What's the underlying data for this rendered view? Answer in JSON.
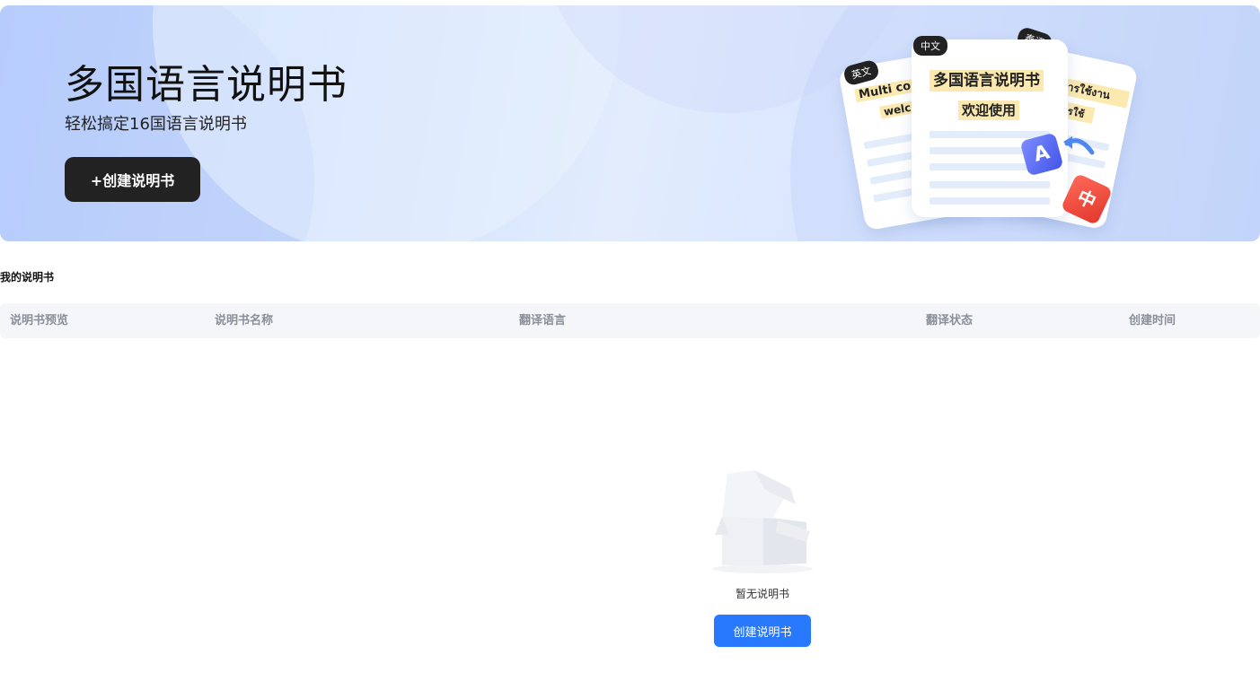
{
  "banner": {
    "title": "多国语言说明书",
    "subtitle": "轻松搞定16国语言说明书",
    "create_button": "+创建说明书",
    "illustration": {
      "tag_left": "英文",
      "tag_center": "中文",
      "tag_right": "泰语",
      "left_line1": "Multi co",
      "left_line2": "welc",
      "center_line1": "多国语言说明书",
      "center_line2": "欢迎使用",
      "right_line1": "การใช้งาน",
      "right_line2": "การใช้",
      "badge_a": "A",
      "badge_zh": "中"
    }
  },
  "section": {
    "title": "我的说明书"
  },
  "table": {
    "columns": [
      "说明书预览",
      "说明书名称",
      "翻译语言",
      "翻译状态",
      "创建时间"
    ]
  },
  "empty_state": {
    "icon": "empty-box-icon",
    "text": "暂无说明书",
    "button": "创建说明书"
  },
  "colors": {
    "primary": "#2979ff",
    "dark_button": "#222222",
    "header_bg": "#f4f6f9"
  }
}
